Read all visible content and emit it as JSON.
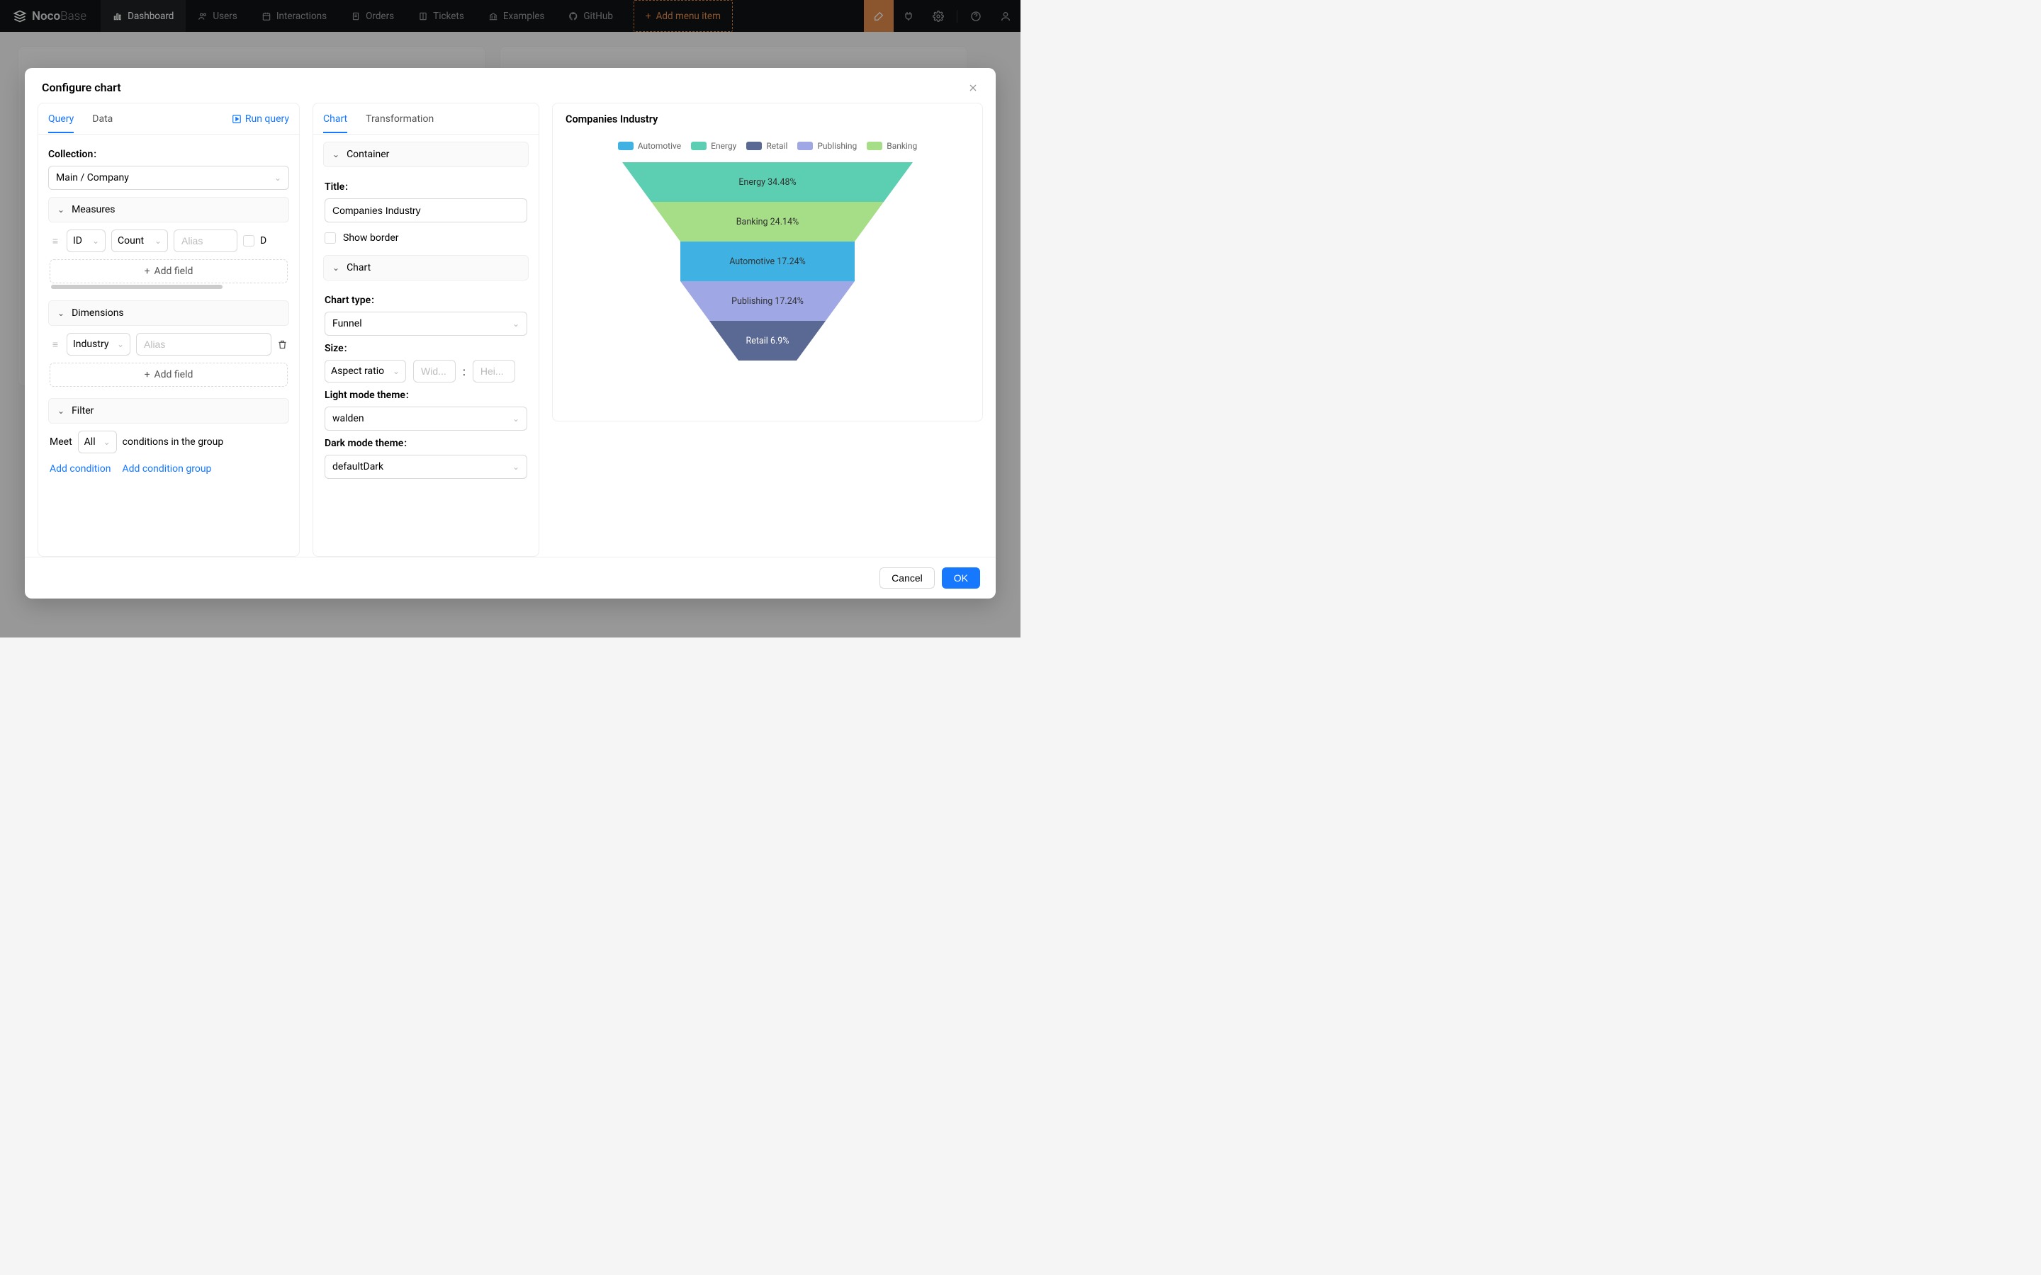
{
  "brand": {
    "name": "Noco",
    "suffix": "Base"
  },
  "nav": [
    {
      "label": "Dashboard",
      "active": true
    },
    {
      "label": "Users"
    },
    {
      "label": "Interactions"
    },
    {
      "label": "Orders"
    },
    {
      "label": "Tickets"
    },
    {
      "label": "Examples"
    },
    {
      "label": "GitHub"
    }
  ],
  "add_menu_label": "Add menu item",
  "modal": {
    "title": "Configure chart",
    "left": {
      "tab_query": "Query",
      "tab_data": "Data",
      "run_query": "Run query",
      "collection_label": "Collection",
      "collection_value": "Main  /  Company",
      "measures_label": "Measures",
      "measure_field": "ID",
      "measure_agg": "Count",
      "measure_alias_ph": "Alias",
      "measure_d": "D",
      "add_field": "Add field",
      "dimensions_label": "Dimensions",
      "dimension_field": "Industry",
      "dimension_alias_ph": "Alias",
      "filter_label": "Filter",
      "filter_meet": "Meet",
      "filter_all": "All",
      "filter_rest": "conditions in the group",
      "add_condition": "Add condition",
      "add_condition_group": "Add condition group"
    },
    "mid": {
      "tab_chart": "Chart",
      "tab_transformation": "Transformation",
      "container_label": "Container",
      "title_label": "Title",
      "title_value": "Companies Industry",
      "show_border": "Show border",
      "chart_section": "Chart",
      "chart_type_label": "Chart type",
      "chart_type_value": "Funnel",
      "size_label": "Size",
      "size_mode": "Aspect ratio",
      "size_w_ph": "Wid...",
      "size_sep": ":",
      "size_h_ph": "Hei...",
      "light_theme_label": "Light mode theme",
      "light_theme_value": "walden",
      "dark_theme_label": "Dark mode theme",
      "dark_theme_value": "defaultDark"
    },
    "footer": {
      "cancel": "Cancel",
      "ok": "OK"
    }
  },
  "chart_preview": {
    "title": "Companies Industry",
    "legend": [
      {
        "label": "Automotive",
        "color": "#3fb2e3"
      },
      {
        "label": "Energy",
        "color": "#5ccfb3"
      },
      {
        "label": "Retail",
        "color": "#5a6993"
      },
      {
        "label": "Publishing",
        "color": "#9fa7e4"
      },
      {
        "label": "Banking",
        "color": "#a6de87"
      }
    ],
    "labels": {
      "energy": "Energy 34.48%",
      "banking": "Banking 24.14%",
      "automotive": "Automotive 17.24%",
      "publishing": "Publishing 17.24%",
      "retail": "Retail 6.9%"
    }
  },
  "chart_data": {
    "type": "funnel",
    "title": "Companies Industry",
    "series": [
      {
        "name": "Energy",
        "value": 34.48,
        "color": "#5ccfb3"
      },
      {
        "name": "Banking",
        "value": 24.14,
        "color": "#a6de87"
      },
      {
        "name": "Automotive",
        "value": 17.24,
        "color": "#3fb2e3"
      },
      {
        "name": "Publishing",
        "value": 17.24,
        "color": "#9fa7e4"
      },
      {
        "name": "Retail",
        "value": 6.9,
        "color": "#5a6993"
      }
    ],
    "unit": "%"
  }
}
